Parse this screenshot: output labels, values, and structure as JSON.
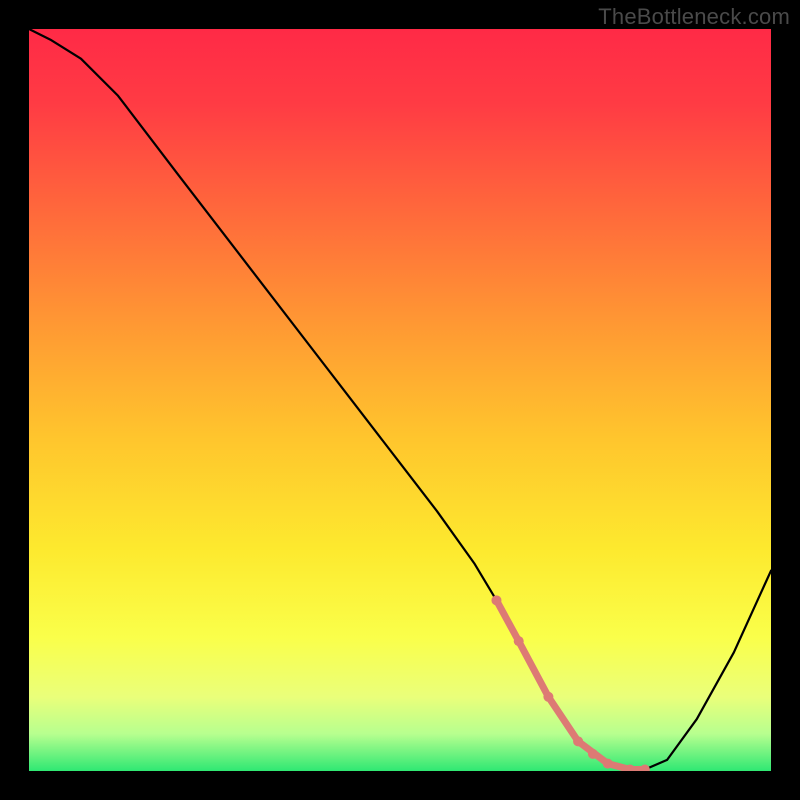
{
  "watermark": "TheBottleneck.com",
  "chart_data": {
    "type": "line",
    "title": "",
    "xlabel": "",
    "ylabel": "",
    "xlim": [
      0,
      100
    ],
    "ylim": [
      0,
      100
    ],
    "series": [
      {
        "name": "curve",
        "color": "#000000",
        "stroke_width": 2.2,
        "x": [
          0,
          3,
          7,
          12,
          20,
          30,
          40,
          50,
          55,
          60,
          63,
          66,
          70,
          74,
          78,
          81,
          83,
          86,
          90,
          95,
          100
        ],
        "y": [
          100,
          98.5,
          96,
          91,
          80.5,
          67.5,
          54.5,
          41.5,
          35,
          28,
          23,
          17.5,
          10,
          4,
          1,
          0.2,
          0.2,
          1.5,
          7,
          16,
          27
        ]
      },
      {
        "name": "valley-highlight",
        "color": "#dd7a74",
        "stroke_width": 7,
        "x": [
          63,
          66,
          70,
          74,
          78,
          81,
          83
        ],
        "y": [
          23,
          17.5,
          10,
          4,
          1,
          0.2,
          0.2
        ],
        "marker_radius": 5,
        "marker_x": [
          63,
          66,
          70,
          74,
          76,
          78,
          81,
          83
        ],
        "marker_y": [
          23,
          17.5,
          10,
          4,
          2.3,
          1,
          0.2,
          0.2
        ]
      }
    ],
    "background_gradient": {
      "type": "vertical",
      "stops": [
        {
          "offset": 0.0,
          "color": "#ff2a46"
        },
        {
          "offset": 0.1,
          "color": "#ff3b44"
        },
        {
          "offset": 0.25,
          "color": "#ff6a3b"
        },
        {
          "offset": 0.4,
          "color": "#ff9933"
        },
        {
          "offset": 0.55,
          "color": "#ffc52d"
        },
        {
          "offset": 0.7,
          "color": "#fde92e"
        },
        {
          "offset": 0.82,
          "color": "#faff4a"
        },
        {
          "offset": 0.9,
          "color": "#eaff7a"
        },
        {
          "offset": 0.95,
          "color": "#b7ff8f"
        },
        {
          "offset": 1.0,
          "color": "#2fe873"
        }
      ]
    }
  }
}
